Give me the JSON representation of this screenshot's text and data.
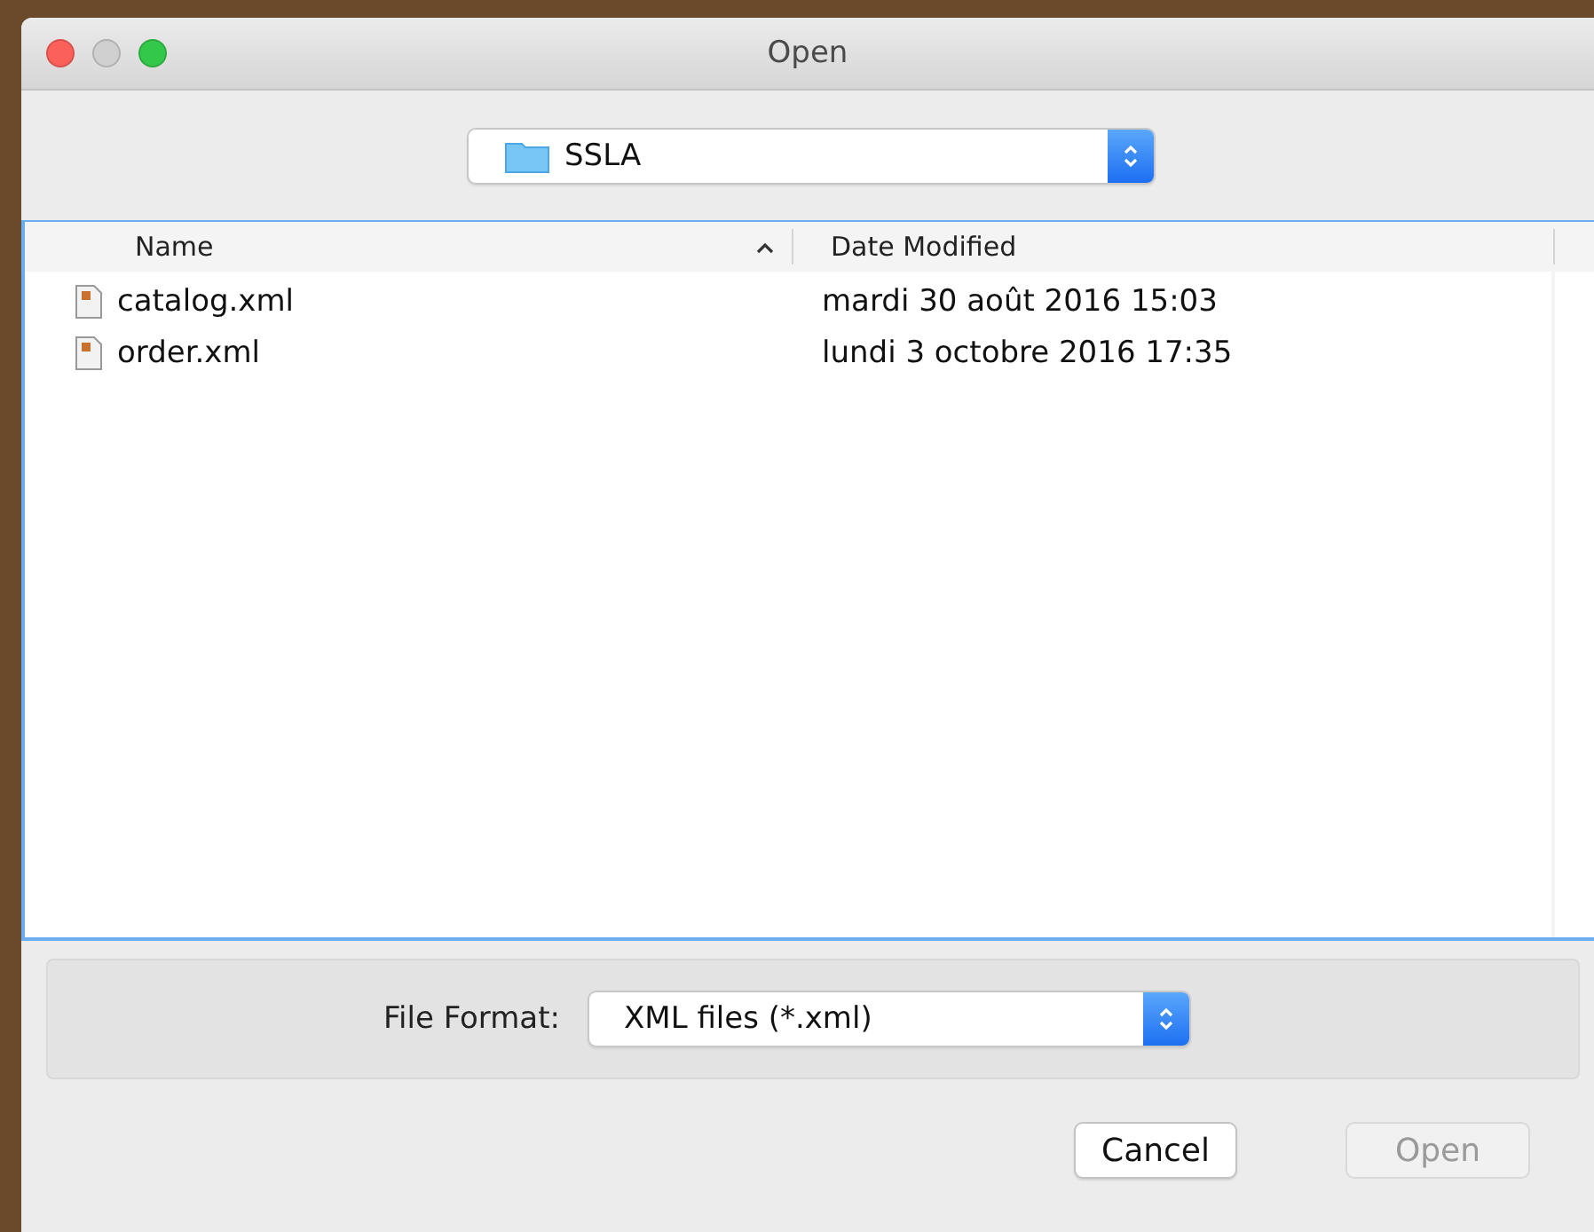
{
  "window": {
    "title": "Open"
  },
  "location": {
    "folder": "SSLA"
  },
  "columns": [
    {
      "label": "Name",
      "sorted": true
    },
    {
      "label": "Date Modified",
      "sorted": false
    }
  ],
  "files": [
    {
      "name": "catalog.xml",
      "date": "mardi 30 août 2016 15:03"
    },
    {
      "name": "order.xml",
      "date": "lundi 3 octobre 2016 17:35"
    }
  ],
  "format": {
    "label": "File Format:",
    "value": "XML files (*.xml)"
  },
  "buttons": [
    {
      "label": "Cancel",
      "disabled": false
    },
    {
      "label": "Open",
      "disabled": true
    }
  ]
}
